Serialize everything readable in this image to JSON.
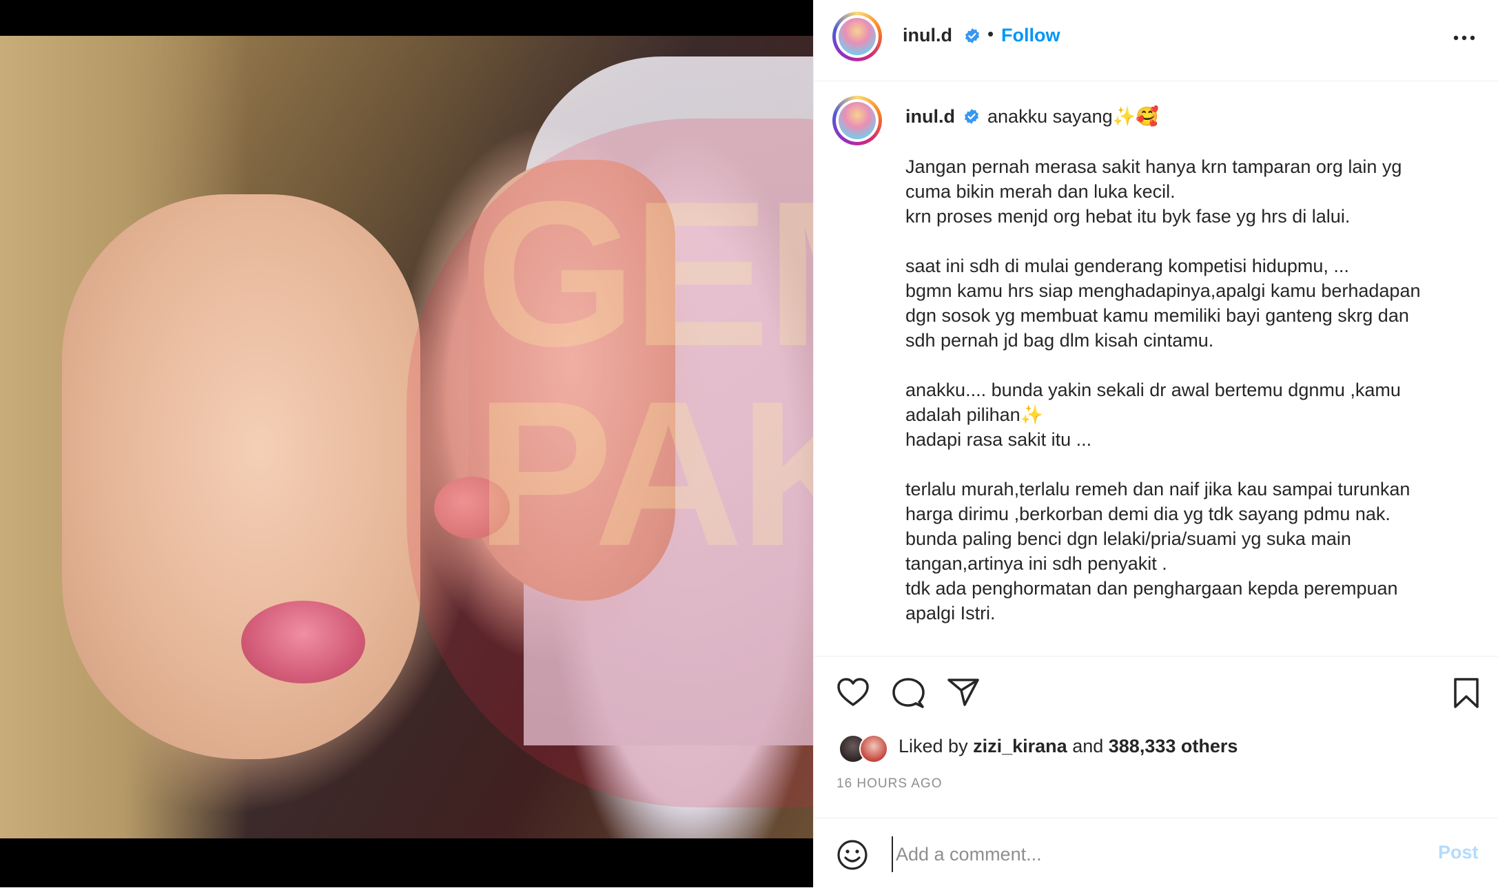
{
  "post": {
    "username": "inul.d",
    "follow_label": "Follow",
    "caption_title": "anakku sayang✨🥰",
    "caption_body": "Jangan pernah merasa sakit hanya krn tamparan org lain yg\ncuma bikin merah dan luka kecil.\nkrn proses menjd org hebat itu byk fase yg hrs di lalui.\n\nsaat ini sdh di mulai genderang kompetisi hidupmu, ...\nbgmn kamu hrs siap menghadapinya,apalgi kamu berhadapan\ndgn sosok yg membuat kamu memiliki bayi ganteng skrg dan\nsdh pernah jd bag dlm kisah cintamu.\n\nanakku.... bunda yakin sekali dr awal bertemu dgnmu ,kamu\nadalah pilihan✨\nhadapi rasa sakit itu ...\n\nterlalu murah,terlalu remeh dan naif jika kau sampai turunkan\nharga dirimu ,berkorban demi dia yg tdk sayang pdmu nak.\nbunda paling benci dgn lelaki/pria/suami yg suka main\ntangan,artinya ini sdh penyakit .\ntdk ada penghormatan dan penghargaan kepda perempuan\napalgi Istri.",
    "likes": {
      "prefix": "Liked by",
      "user": "zizi_kirana",
      "joiner": "and",
      "count": "388,333 others"
    },
    "timestamp": "16 HOURS AGO",
    "comment_placeholder": "Add a comment...",
    "post_label": "Post",
    "watermark_text": "GEM\nPAK"
  },
  "colors": {
    "link_blue": "#0095f6",
    "post_disabled": "#b3dbff",
    "verified": "#3897f0",
    "muted": "#8e8e8e"
  },
  "icons": [
    "verified-badge-icon",
    "more-options-icon",
    "heart-icon",
    "comment-icon",
    "share-icon",
    "bookmark-icon",
    "emoji-icon"
  ]
}
